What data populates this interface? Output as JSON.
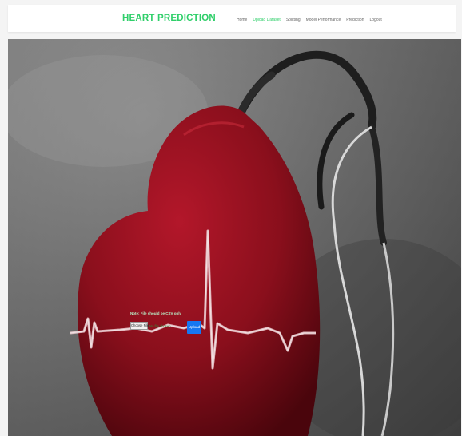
{
  "brand": {
    "title": "HEART PREDICTION"
  },
  "nav": {
    "items": [
      {
        "label": "Home",
        "active": false
      },
      {
        "label": "Upload Dataset",
        "active": true
      },
      {
        "label": "Splitting",
        "active": false
      },
      {
        "label": "Model Performance",
        "active": false
      },
      {
        "label": "Prediction",
        "active": false
      },
      {
        "label": "Logout",
        "active": false
      }
    ]
  },
  "upload": {
    "note": "Note: File should be CSV only",
    "choose_label": "Choose File",
    "no_file_text": "No file chosen",
    "submit_label": "Upload"
  },
  "colors": {
    "accent": "#2fcf6a",
    "button_blue": "#1677f2",
    "heart_red": "#9e1020"
  }
}
